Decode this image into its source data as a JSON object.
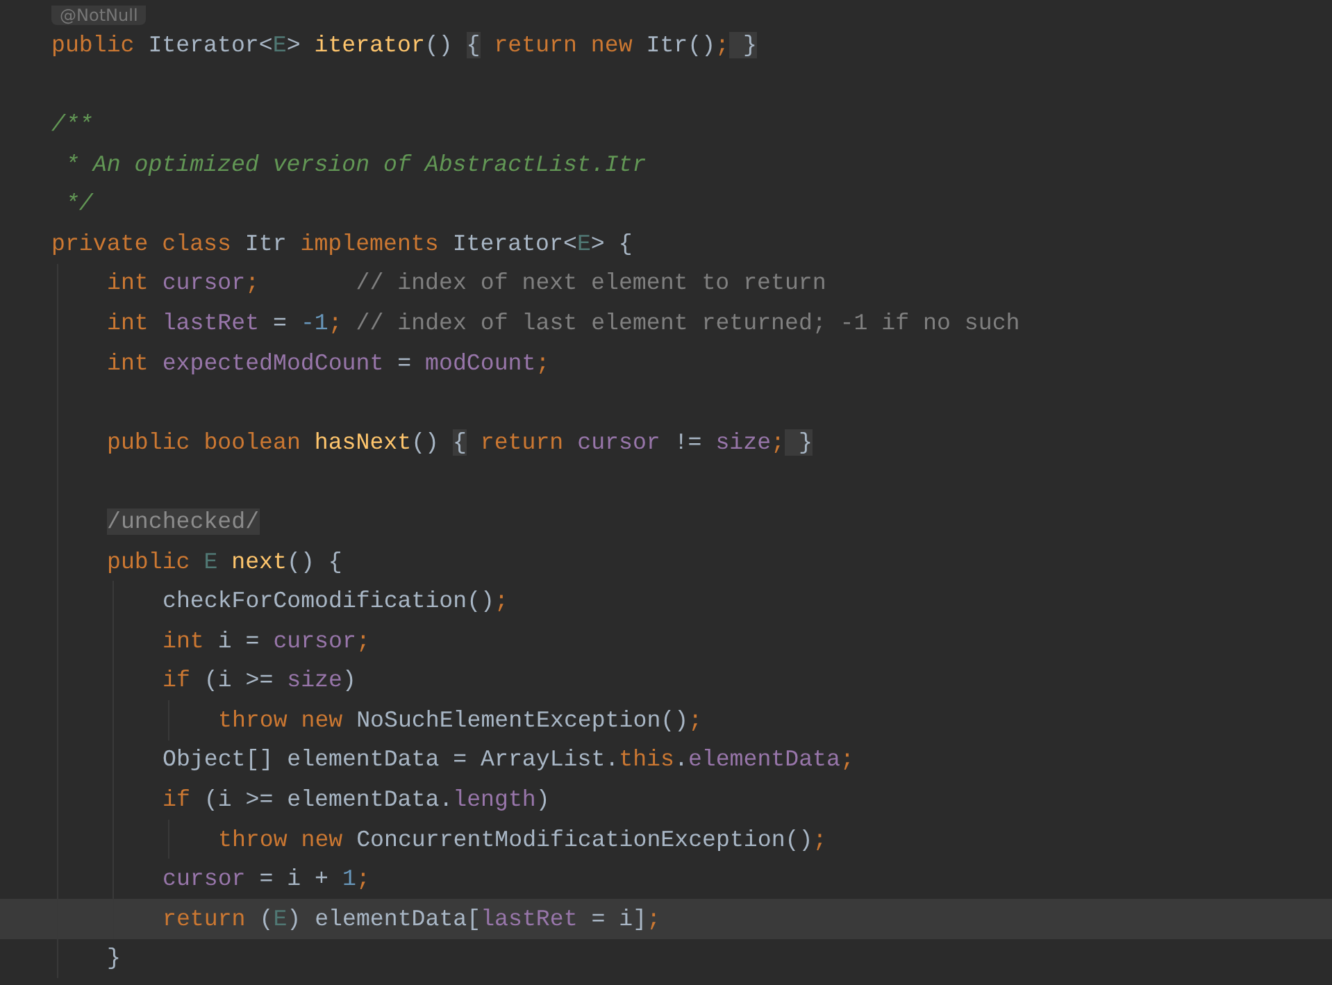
{
  "editor": {
    "annotation_hint": "@NotNull",
    "lines": [
      {
        "selected": false,
        "tokens": [
          {
            "text": "public ",
            "kind": "keyword"
          },
          {
            "text": "Iterator<",
            "kind": "plain"
          },
          {
            "text": "E",
            "kind": "generic"
          },
          {
            "text": "> ",
            "kind": "plain"
          },
          {
            "text": "iterator",
            "kind": "method"
          },
          {
            "text": "() ",
            "kind": "plain"
          },
          {
            "text": "{",
            "kind": "fold"
          },
          {
            "text": " return new ",
            "kind": "keyword"
          },
          {
            "text": "Itr()",
            "kind": "plain"
          },
          {
            "text": ";",
            "kind": "keyword"
          },
          {
            "text": " }",
            "kind": "fold"
          }
        ]
      },
      {
        "selected": false
      },
      {
        "selected": false,
        "tokens": [
          {
            "text": "/**",
            "kind": "doc"
          }
        ]
      },
      {
        "selected": false,
        "tokens": [
          {
            "text": " * An optimized version of AbstractList.Itr",
            "kind": "doc"
          }
        ]
      },
      {
        "selected": false,
        "tokens": [
          {
            "text": " */",
            "kind": "doc"
          }
        ]
      },
      {
        "selected": false,
        "tokens": [
          {
            "text": "private class ",
            "kind": "keyword"
          },
          {
            "text": "Itr ",
            "kind": "plain"
          },
          {
            "text": "implements ",
            "kind": "keyword"
          },
          {
            "text": "Iterator<",
            "kind": "plain"
          },
          {
            "text": "E",
            "kind": "generic"
          },
          {
            "text": "> {",
            "kind": "plain"
          }
        ],
        "children": [
          {
            "selected": false,
            "tokens": [
              {
                "text": "int ",
                "kind": "keyword"
              },
              {
                "text": "cursor",
                "kind": "field"
              },
              {
                "text": ";",
                "kind": "keyword"
              },
              {
                "text": "       // index of next element to return",
                "kind": "comment"
              }
            ]
          },
          {
            "selected": false,
            "tokens": [
              {
                "text": "int ",
                "kind": "keyword"
              },
              {
                "text": "lastRet",
                "kind": "field"
              },
              {
                "text": " = ",
                "kind": "plain"
              },
              {
                "text": "-1",
                "kind": "number"
              },
              {
                "text": ";",
                "kind": "keyword"
              },
              {
                "text": " // index of last element returned; -1 if no such",
                "kind": "comment"
              }
            ]
          },
          {
            "selected": false,
            "tokens": [
              {
                "text": "int ",
                "kind": "keyword"
              },
              {
                "text": "expectedModCount",
                "kind": "field"
              },
              {
                "text": " = ",
                "kind": "plain"
              },
              {
                "text": "modCount",
                "kind": "field"
              },
              {
                "text": ";",
                "kind": "keyword"
              }
            ]
          },
          {
            "selected": false
          },
          {
            "selected": false,
            "tokens": [
              {
                "text": "public boolean ",
                "kind": "keyword"
              },
              {
                "text": "hasNext",
                "kind": "method"
              },
              {
                "text": "() ",
                "kind": "plain"
              },
              {
                "text": "{",
                "kind": "fold"
              },
              {
                "text": " return ",
                "kind": "keyword"
              },
              {
                "text": "cursor",
                "kind": "field"
              },
              {
                "text": " != ",
                "kind": "plain"
              },
              {
                "text": "size",
                "kind": "field"
              },
              {
                "text": ";",
                "kind": "keyword"
              },
              {
                "text": " }",
                "kind": "fold"
              }
            ]
          },
          {
            "selected": false
          },
          {
            "selected": false,
            "tokens": [
              {
                "text": "/unchecked/",
                "kind": "folded"
              }
            ]
          },
          {
            "selected": false,
            "tokens": [
              {
                "text": "public ",
                "kind": "keyword"
              },
              {
                "text": "E ",
                "kind": "generic"
              },
              {
                "text": "next",
                "kind": "method"
              },
              {
                "text": "() {",
                "kind": "plain"
              }
            ],
            "children": [
              {
                "selected": false,
                "tokens": [
                  {
                    "text": "checkForComodification()",
                    "kind": "plain"
                  },
                  {
                    "text": ";",
                    "kind": "keyword"
                  }
                ]
              },
              {
                "selected": false,
                "tokens": [
                  {
                    "text": "int ",
                    "kind": "keyword"
                  },
                  {
                    "text": "i = ",
                    "kind": "plain"
                  },
                  {
                    "text": "cursor",
                    "kind": "field"
                  },
                  {
                    "text": ";",
                    "kind": "keyword"
                  }
                ]
              },
              {
                "selected": false,
                "tokens": [
                  {
                    "text": "if ",
                    "kind": "keyword"
                  },
                  {
                    "text": "(i >= ",
                    "kind": "plain"
                  },
                  {
                    "text": "size",
                    "kind": "field"
                  },
                  {
                    "text": ")",
                    "kind": "plain"
                  }
                ],
                "children": [
                  {
                    "selected": false,
                    "tokens": [
                      {
                        "text": "throw new ",
                        "kind": "keyword"
                      },
                      {
                        "text": "NoSuchElementException()",
                        "kind": "plain"
                      },
                      {
                        "text": ";",
                        "kind": "keyword"
                      }
                    ]
                  }
                ]
              },
              {
                "selected": false,
                "tokens": [
                  {
                    "text": "Object[] elementData = ArrayList.",
                    "kind": "plain"
                  },
                  {
                    "text": "this",
                    "kind": "keyword"
                  },
                  {
                    "text": ".",
                    "kind": "plain"
                  },
                  {
                    "text": "elementData",
                    "kind": "field"
                  },
                  {
                    "text": ";",
                    "kind": "keyword"
                  }
                ]
              },
              {
                "selected": false,
                "tokens": [
                  {
                    "text": "if ",
                    "kind": "keyword"
                  },
                  {
                    "text": "(i >= elementData.",
                    "kind": "plain"
                  },
                  {
                    "text": "length",
                    "kind": "field"
                  },
                  {
                    "text": ")",
                    "kind": "plain"
                  }
                ],
                "children": [
                  {
                    "selected": false,
                    "tokens": [
                      {
                        "text": "throw new ",
                        "kind": "keyword"
                      },
                      {
                        "text": "ConcurrentModificationException()",
                        "kind": "plain"
                      },
                      {
                        "text": ";",
                        "kind": "keyword"
                      }
                    ]
                  }
                ]
              },
              {
                "selected": false,
                "tokens": [
                  {
                    "text": "cursor",
                    "kind": "field"
                  },
                  {
                    "text": " = i + ",
                    "kind": "plain"
                  },
                  {
                    "text": "1",
                    "kind": "number"
                  },
                  {
                    "text": ";",
                    "kind": "keyword"
                  }
                ]
              },
              {
                "selected": true,
                "tokens": [
                  {
                    "text": "return ",
                    "kind": "keyword"
                  },
                  {
                    "text": "(",
                    "kind": "plain"
                  },
                  {
                    "text": "E",
                    "kind": "generic"
                  },
                  {
                    "text": ") elementData[",
                    "kind": "plain"
                  },
                  {
                    "text": "lastRet",
                    "kind": "field"
                  },
                  {
                    "text": " = i]",
                    "kind": "plain"
                  },
                  {
                    "text": ";",
                    "kind": "keyword"
                  }
                ]
              }
            ]
          },
          {
            "selected": false,
            "tokens": [
              {
                "text": "}",
                "kind": "plain"
              }
            ]
          }
        ]
      }
    ]
  }
}
